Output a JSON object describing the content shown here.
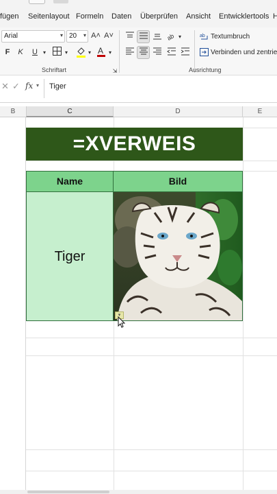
{
  "menu": {
    "tabs": [
      "fügen",
      "Seitenlayout",
      "Formeln",
      "Daten",
      "Überprüfen",
      "Ansicht",
      "Entwicklertools",
      "H"
    ]
  },
  "ribbon": {
    "font_name": "Arial",
    "font_size": "20",
    "grow_font": "A˄",
    "shrink_font": "A˅",
    "bold": "F",
    "italic": "K",
    "underline": "U",
    "font_group_label": "Schriftart",
    "alignment_group_label": "Ausrichtung",
    "wrap_text": "Textumbruch",
    "merge_center": "Verbinden und zentrieren"
  },
  "formula_bar": {
    "cancel_icon": "✕",
    "confirm_icon": "✓",
    "fx": "fx",
    "content": "Tiger"
  },
  "columns": [
    "B",
    "C",
    "D",
    "E"
  ],
  "sheet": {
    "title": "=XVERWEIS",
    "header_name": "Name",
    "header_image": "Bild",
    "name_value": "Tiger"
  },
  "colors": {
    "title_bg": "#2e5719",
    "header_bg": "#7dd38c",
    "name_bg": "#c6efce",
    "border": "#2f6e3b"
  },
  "image": {
    "subject": "white-tiger-photo"
  }
}
